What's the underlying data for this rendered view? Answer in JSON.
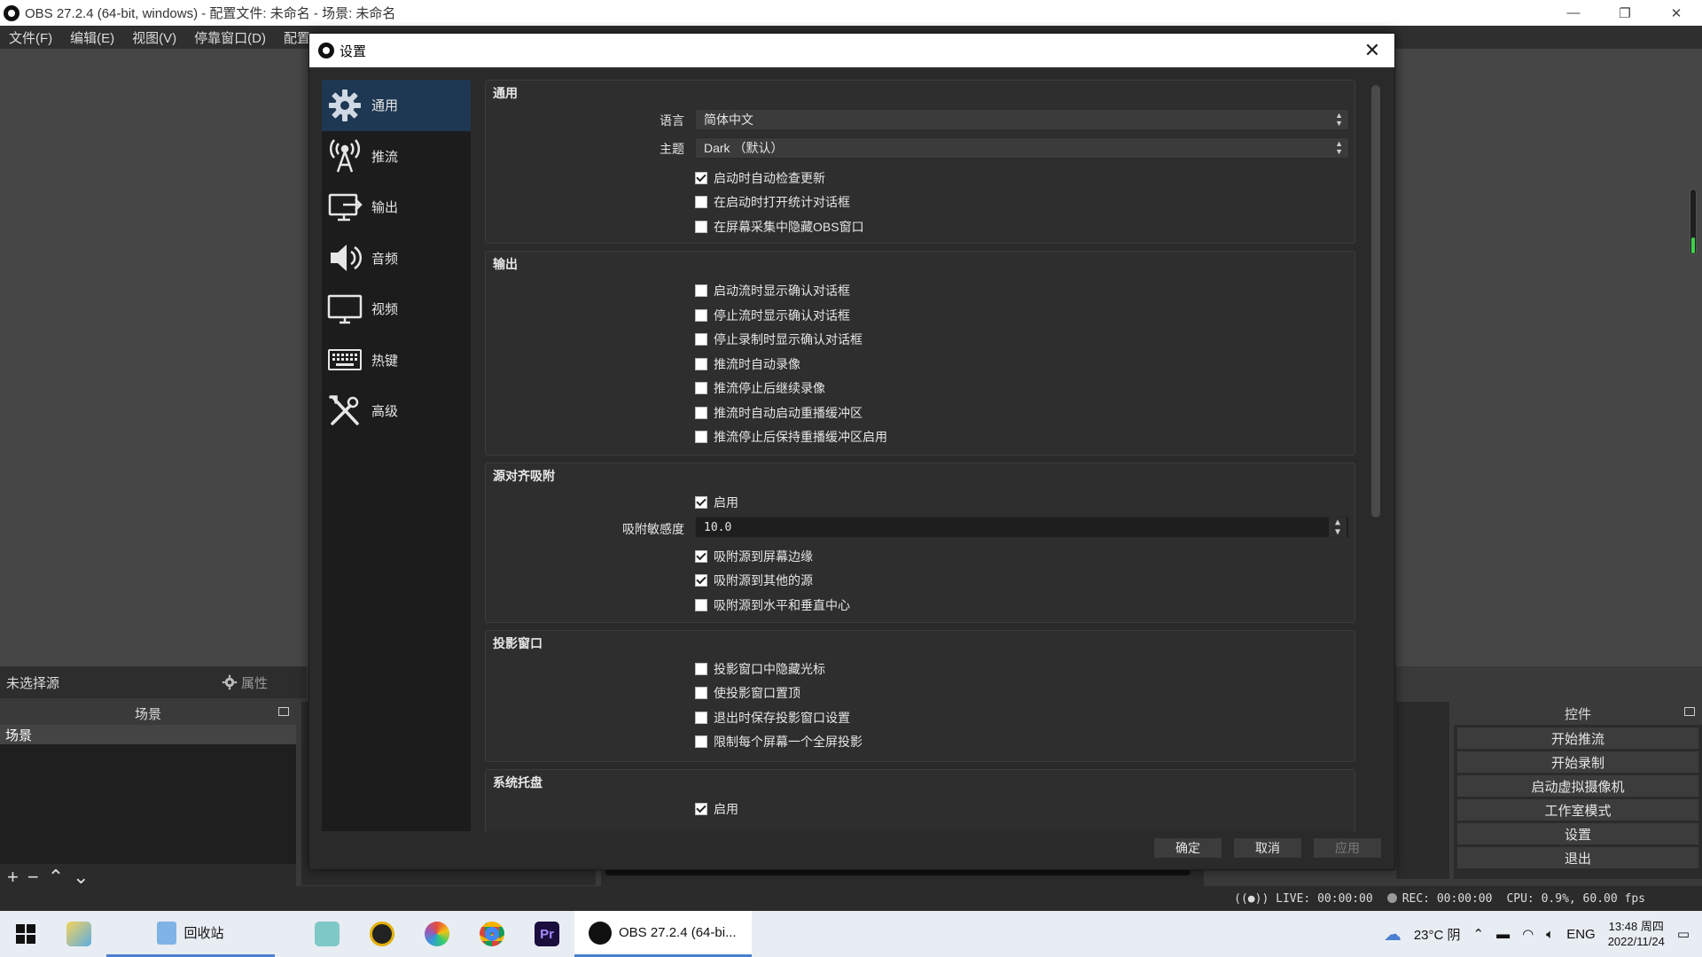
{
  "window": {
    "title": "OBS 27.2.4 (64-bit, windows) - 配置文件: 未命名 - 场景: 未命名",
    "minimize": "—",
    "maximize": "❐",
    "close": "✕"
  },
  "menubar": {
    "items": [
      "文件(F)",
      "编辑(E)",
      "视图(V)",
      "停靠窗口(D)",
      "配置"
    ]
  },
  "source_bar": {
    "no_source": "未选择源",
    "properties": "属性"
  },
  "scenes_dock": {
    "title": "场景",
    "items": [
      "场景"
    ]
  },
  "controls_dock": {
    "title": "控件",
    "buttons": [
      "开始推流",
      "开始录制",
      "启动虚拟摄像机",
      "工作室模式",
      "设置",
      "退出"
    ]
  },
  "statusbar": {
    "live": "LIVE: 00:00:00",
    "rec": "REC: 00:00:00",
    "cpu": "CPU: 0.9%, 60.00 fps"
  },
  "dialog": {
    "title": "设置",
    "nav": [
      {
        "label": "通用",
        "icon": "gear-icon"
      },
      {
        "label": "推流",
        "icon": "antenna-icon"
      },
      {
        "label": "输出",
        "icon": "output-icon"
      },
      {
        "label": "音频",
        "icon": "speaker-icon"
      },
      {
        "label": "视频",
        "icon": "monitor-icon"
      },
      {
        "label": "热键",
        "icon": "keyboard-icon"
      },
      {
        "label": "高级",
        "icon": "tools-icon"
      }
    ],
    "general": {
      "title": "通用",
      "language_label": "语言",
      "language_value": "简体中文",
      "theme_label": "主题",
      "theme_value": "Dark （默认）",
      "checks": [
        {
          "label": "启动时自动检查更新",
          "checked": true
        },
        {
          "label": "在启动时打开统计对话框",
          "checked": false
        },
        {
          "label": "在屏幕采集中隐藏OBS窗口",
          "checked": false
        }
      ]
    },
    "output": {
      "title": "输出",
      "checks": [
        {
          "label": "启动流时显示确认对话框",
          "checked": false
        },
        {
          "label": "停止流时显示确认对话框",
          "checked": false
        },
        {
          "label": "停止录制时显示确认对话框",
          "checked": false
        },
        {
          "label": "推流时自动录像",
          "checked": false
        },
        {
          "label": "推流停止后继续录像",
          "checked": false
        },
        {
          "label": "推流时自动启动重播缓冲区",
          "checked": false
        },
        {
          "label": "推流停止后保持重播缓冲区启用",
          "checked": false
        }
      ]
    },
    "snapping": {
      "title": "源对齐吸附",
      "enable": {
        "label": "启用",
        "checked": true
      },
      "sensitivity_label": "吸附敏感度",
      "sensitivity_value": "10.0",
      "checks": [
        {
          "label": "吸附源到屏幕边缘",
          "checked": true
        },
        {
          "label": "吸附源到其他的源",
          "checked": true
        },
        {
          "label": "吸附源到水平和垂直中心",
          "checked": false
        }
      ]
    },
    "projector": {
      "title": "投影窗口",
      "checks": [
        {
          "label": "投影窗口中隐藏光标",
          "checked": false
        },
        {
          "label": "使投影窗口置顶",
          "checked": false
        },
        {
          "label": "退出时保存投影窗口设置",
          "checked": false
        },
        {
          "label": "限制每个屏幕一个全屏投影",
          "checked": false
        }
      ]
    },
    "tray": {
      "title": "系统托盘",
      "enable": {
        "label": "启用",
        "checked": true
      }
    },
    "buttons": {
      "ok": "确定",
      "cancel": "取消",
      "apply": "应用"
    }
  },
  "taskbar": {
    "recycle_label": "回收站",
    "obs_label": "OBS 27.2.4 (64-bi...",
    "weather": "23°C 阴",
    "ime": "ENG",
    "time": "13:48 周四",
    "date": "2022/11/24"
  }
}
